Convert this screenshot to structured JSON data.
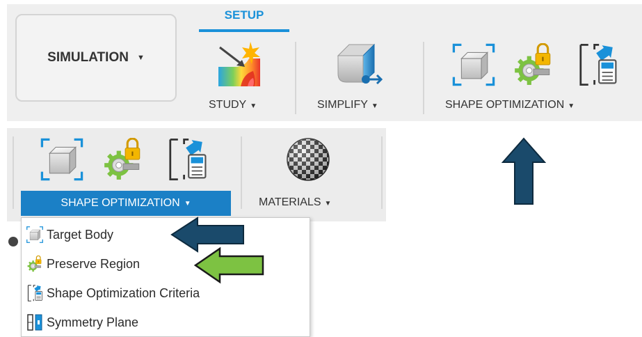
{
  "top_toolbar": {
    "workspace_button": {
      "label": "SIMULATION"
    },
    "active_tab": {
      "label": "SETUP"
    },
    "groups": {
      "study": {
        "label": "STUDY"
      },
      "simplify": {
        "label": "SIMPLIFY"
      },
      "shape_optimization": {
        "label": "SHAPE OPTIMIZATION"
      }
    }
  },
  "bottom_toolbar": {
    "shape_optimization": {
      "label": "SHAPE OPTIMIZATION"
    },
    "materials": {
      "label": "MATERIALS"
    }
  },
  "dropdown": {
    "items": [
      {
        "label": "Target Body",
        "icon": "target-body-icon"
      },
      {
        "label": "Preserve Region",
        "icon": "preserve-region-icon"
      },
      {
        "label": "Shape Optimization Criteria",
        "icon": "shape-optimization-criteria-icon"
      },
      {
        "label": "Symmetry Plane",
        "icon": "symmetry-plane-icon"
      }
    ]
  },
  "annotations": {
    "arrows": [
      {
        "name": "up-arrow",
        "color": "#1a4a6b"
      },
      {
        "name": "target-body-arrow",
        "color": "#1a4a6b"
      },
      {
        "name": "preserve-region-arrow",
        "color": "#7dc242"
      }
    ]
  },
  "colors": {
    "accent": "#1a91d9",
    "active_label_bg": "#1b80c6",
    "dark_arrow": "#1a4a6b",
    "green_arrow": "#7dc242"
  }
}
